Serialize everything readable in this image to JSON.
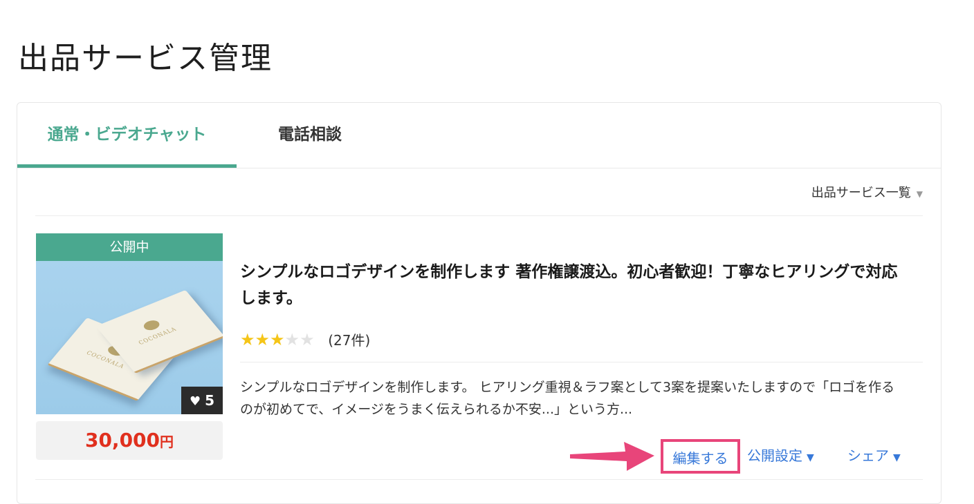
{
  "page": {
    "title": "出品サービス管理"
  },
  "tabs": [
    {
      "label": "通常・ビデオチャット",
      "active": true
    },
    {
      "label": "電話相談",
      "active": false
    }
  ],
  "list_select": {
    "label": "出品サービス一覧"
  },
  "service": {
    "status": "公開中",
    "thumbnail_brand": "COCONALA",
    "favorites": "5",
    "price": "30,000",
    "price_unit": "円",
    "title": "シンプルなロゴデザインを制作します 著作権譲渡込。初心者歓迎！丁寧なヒアリングで対応します。",
    "rating": {
      "stars_filled": 3,
      "stars_total": 5,
      "count_text": "(27件)"
    },
    "description": "シンプルなロゴデザインを制作します。 ヒアリング重視＆ラフ案として3案を提案いたしますので「ロゴを作るのが初めてで、イメージをうまく伝えられるか不安...」という方...",
    "actions": {
      "edit": "編集する",
      "publish_settings": "公開設定",
      "share": "シェア"
    }
  },
  "colors": {
    "accent": "#4aa88f",
    "price": "#e0301e",
    "link": "#3879d9",
    "highlight": "#e8457a",
    "star": "#f5c518"
  }
}
